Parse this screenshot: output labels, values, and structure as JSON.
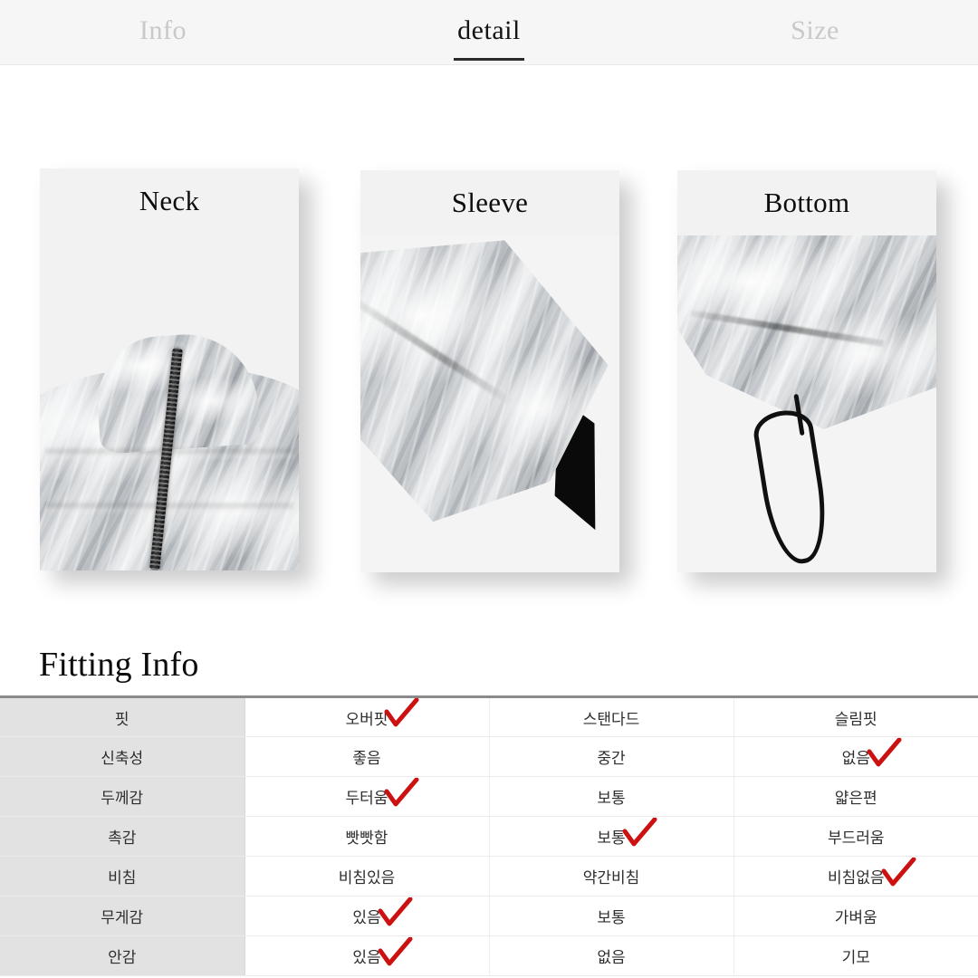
{
  "page": {
    "background": "#ffffff",
    "accent_check_color": "#cc1111"
  },
  "tabs": {
    "items": [
      {
        "id": "info",
        "label": "Info",
        "active": false
      },
      {
        "id": "detail",
        "label": "detail",
        "active": true
      },
      {
        "id": "size",
        "label": "Size",
        "active": false
      }
    ]
  },
  "gallery": {
    "cards": [
      {
        "id": "neck",
        "title": "Neck",
        "alt": "silver puffer jacket collar with black zipper"
      },
      {
        "id": "sleeve",
        "title": "Sleeve",
        "alt": "silver puffer jacket sleeve cuff with black trim"
      },
      {
        "id": "bottom",
        "title": "Bottom",
        "alt": "silver puffer jacket hem with black drawcord loop"
      }
    ]
  },
  "fitting": {
    "heading": "Fitting Info",
    "rows": [
      {
        "label": "핏",
        "options": [
          {
            "text": "오버핏",
            "checked": true
          },
          {
            "text": "스탠다드",
            "checked": false
          },
          {
            "text": "슬림핏",
            "checked": false
          }
        ]
      },
      {
        "label": "신축성",
        "options": [
          {
            "text": "좋음",
            "checked": false
          },
          {
            "text": "중간",
            "checked": false
          },
          {
            "text": "없음",
            "checked": true
          }
        ]
      },
      {
        "label": "두께감",
        "options": [
          {
            "text": "두터움",
            "checked": true
          },
          {
            "text": "보통",
            "checked": false
          },
          {
            "text": "얇은편",
            "checked": false
          }
        ]
      },
      {
        "label": "촉감",
        "options": [
          {
            "text": "빳빳함",
            "checked": false
          },
          {
            "text": "보통",
            "checked": true
          },
          {
            "text": "부드러움",
            "checked": false
          }
        ]
      },
      {
        "label": "비침",
        "options": [
          {
            "text": "비침있음",
            "checked": false
          },
          {
            "text": "약간비침",
            "checked": false
          },
          {
            "text": "비침없음",
            "checked": true
          }
        ]
      },
      {
        "label": "무게감",
        "options": [
          {
            "text": "있음",
            "checked": true
          },
          {
            "text": "보통",
            "checked": false
          },
          {
            "text": "가벼움",
            "checked": false
          }
        ]
      },
      {
        "label": "안감",
        "options": [
          {
            "text": "있음",
            "checked": true
          },
          {
            "text": "없음",
            "checked": false
          },
          {
            "text": "기모",
            "checked": false
          }
        ]
      }
    ]
  }
}
